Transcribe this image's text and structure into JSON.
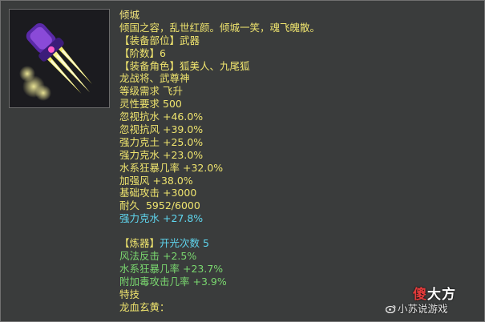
{
  "item": {
    "name": "倾城",
    "description": "倾国之容，乱世红颜。倾城一笑，魂飞魄散。",
    "slot_label": "【装备部位】",
    "slot_value": "武器",
    "tier_label": "【阶数】",
    "tier_value": "6",
    "role_label": "【装备角色】",
    "role_value": "狐美人、九尾狐",
    "role_value_2": "龙战将、武尊神",
    "level_req_label": "等级需求",
    "level_req_value": "飞升",
    "spirit_req_label": "灵性要求",
    "spirit_req_value": "500"
  },
  "stats": [
    {
      "label": "忽视抗水",
      "value": "+46.0%"
    },
    {
      "label": "忽视抗风",
      "value": "+39.0%"
    },
    {
      "label": "强力克土",
      "value": "+25.0%"
    },
    {
      "label": "强力克水",
      "value": "+23.0%"
    },
    {
      "label": "水系狂暴几率",
      "value": "+32.0%"
    },
    {
      "label": "加强风",
      "value": "+38.0%"
    },
    {
      "label": "基础攻击",
      "value": "+3000"
    },
    {
      "label": "耐久",
      "value": "5952/6000"
    }
  ],
  "bonus_stat": {
    "label": "强力克水",
    "value": "+27.8%"
  },
  "refine": {
    "header_label": "【炼器】",
    "header_value": "开光次数 5",
    "stats": [
      {
        "label": "风法反击",
        "value": "+2.5%"
      },
      {
        "label": "水系狂暴几率",
        "value": "+23.7%"
      },
      {
        "label": "附加毒攻击几率",
        "value": "+3.9%"
      }
    ]
  },
  "special": {
    "label": "特技",
    "value": "龙血玄黄："
  },
  "watermark": {
    "logo": "傻大方",
    "logo_red": "傻",
    "logo_rest": "大方",
    "sub": "小苏说游戏",
    "sub_icon": "weibo-icon"
  },
  "colors": {
    "title": "#f1e37c",
    "attribute": "#efe46e",
    "refine": "#7ad86f",
    "bonus": "#5fd6ef"
  }
}
